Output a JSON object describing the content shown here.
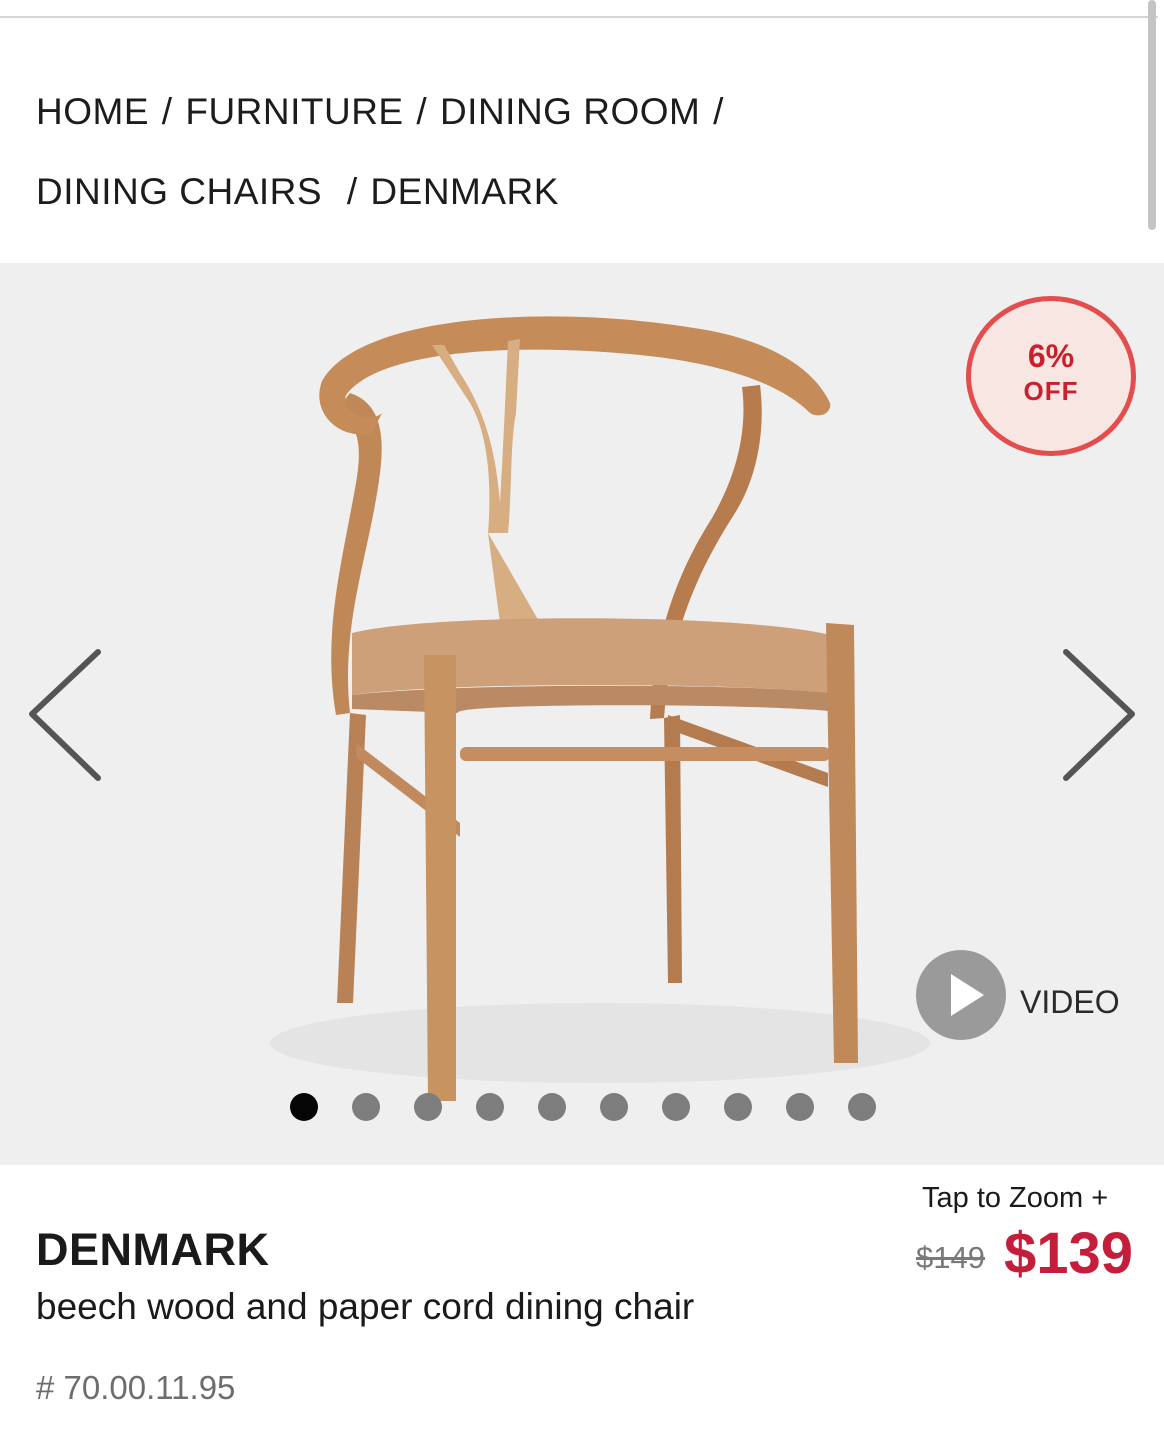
{
  "breadcrumb": {
    "home": "HOME",
    "furniture": "FURNITURE",
    "dining_room": "DINING ROOM",
    "dining_chairs": "DINING CHAIRS",
    "current": "DENMARK",
    "separator": "/"
  },
  "gallery": {
    "discount_percent": "6%",
    "discount_label": "OFF",
    "video_label": "VIDEO",
    "image_count": 10,
    "active_index": 0,
    "prev_icon": "chevron-left-icon",
    "next_icon": "chevron-right-icon"
  },
  "zoom": {
    "label": "Tap to Zoom +"
  },
  "product": {
    "name": "DENMARK",
    "description": "beech wood and paper cord dining chair",
    "sku": "# 70.00.11.95",
    "price_old": "$149",
    "price_new": "$139"
  },
  "colors": {
    "accent_red": "#c41e3a",
    "badge_border": "#e34d4d",
    "badge_fill": "#f7e6e1",
    "gallery_bg": "#efefef"
  }
}
